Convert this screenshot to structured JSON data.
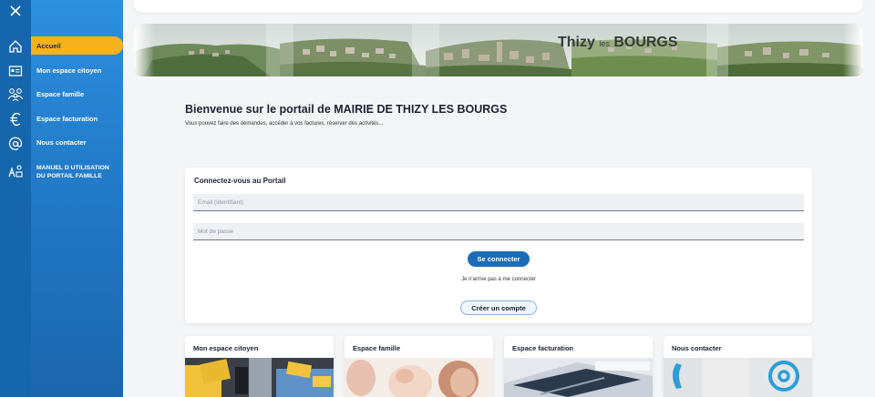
{
  "rail": {
    "icons": [
      "close-icon",
      "home-icon",
      "id-card-icon",
      "family-icon",
      "euro-icon",
      "at-icon",
      "manual-icon"
    ]
  },
  "sidebar": {
    "items": [
      {
        "label": "Accueil",
        "icon": "home-icon",
        "active": true
      },
      {
        "label": "Mon espace citoyen",
        "icon": "id-card-icon"
      },
      {
        "label": "Espace famille",
        "icon": "family-icon"
      },
      {
        "label": "Espace facturation",
        "icon": "euro-icon"
      },
      {
        "label": "Nous contacter",
        "icon": "at-icon"
      },
      {
        "label": "MANUEL D UTILISATION",
        "label2": "DU PORTAIL FAMILLE",
        "icon": "manual-icon"
      }
    ]
  },
  "banner": {
    "logo_main": "Thizy",
    "logo_small": "les",
    "logo_end": "BOURGS"
  },
  "welcome": {
    "title": "Bienvenue sur le portail de MAIRIE DE THIZY LES BOURGS",
    "text": "Vous pouvez faire des demandes, accéder à vos factures, réserver des activités..."
  },
  "login": {
    "title": "Connectez-vous au Portail",
    "email_placeholder": "Email (identifiant)",
    "password_placeholder": "Mot de passe",
    "connect_label": "Se connecter",
    "problem_label": "Je n'arrive pas à me connecter",
    "create_label": "Créer un compte"
  },
  "tiles": [
    {
      "title": "Mon espace citoyen"
    },
    {
      "title": "Espace famille"
    },
    {
      "title": "Espace facturation"
    },
    {
      "title": "Nous contacter"
    }
  ],
  "colors": {
    "sidebar": "#2178c6",
    "rail": "#1566ad",
    "active": "#f5b21a",
    "primary_button": "#1b6bb7"
  }
}
